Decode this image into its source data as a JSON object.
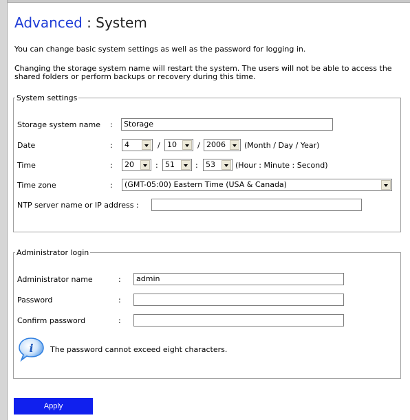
{
  "header": {
    "crumb": "Advanced",
    "separator": " : ",
    "page_title": "System"
  },
  "intro": {
    "line1": "You can change basic system settings as well as the password for logging in.",
    "line2a": "Changing the storage system name will restart the system. The users will not be able to access the",
    "line2b": "shared folders or perform backups or recovery during this time."
  },
  "system_settings": {
    "legend": "System settings",
    "name_label": "Storage system name",
    "name_value": "Storage",
    "date_label": "Date",
    "date_month": "4",
    "date_day": "10",
    "date_year": "2006",
    "date_hint": "(Month / Day / Year)",
    "time_label": "Time",
    "time_hour": "20",
    "time_minute": "51",
    "time_second": "53",
    "time_hint": "(Hour : Minute : Second)",
    "tz_label": "Time zone",
    "tz_value": "(GMT-05:00) Eastern Time (USA & Canada)",
    "ntp_label": "NTP server name or IP address :",
    "ntp_value": "",
    "colon": ":",
    "slash": "/"
  },
  "admin": {
    "legend": "Administrator login",
    "name_label": "Administrator name",
    "name_value": "admin",
    "password_label": "Password",
    "password_value": "",
    "confirm_label": "Confirm password",
    "confirm_value": "",
    "note": "The password cannot exceed eight characters.",
    "info_icon_glyph": "i",
    "colon": ":"
  },
  "actions": {
    "apply_label": "Apply"
  },
  "colors": {
    "title_blue": "#1d3bd6",
    "apply_bg": "#1020ee",
    "info_blue": "#2f7fe0"
  },
  "icons": {
    "info": "info-bubble-icon",
    "dropdown": "chevron-down-icon"
  }
}
